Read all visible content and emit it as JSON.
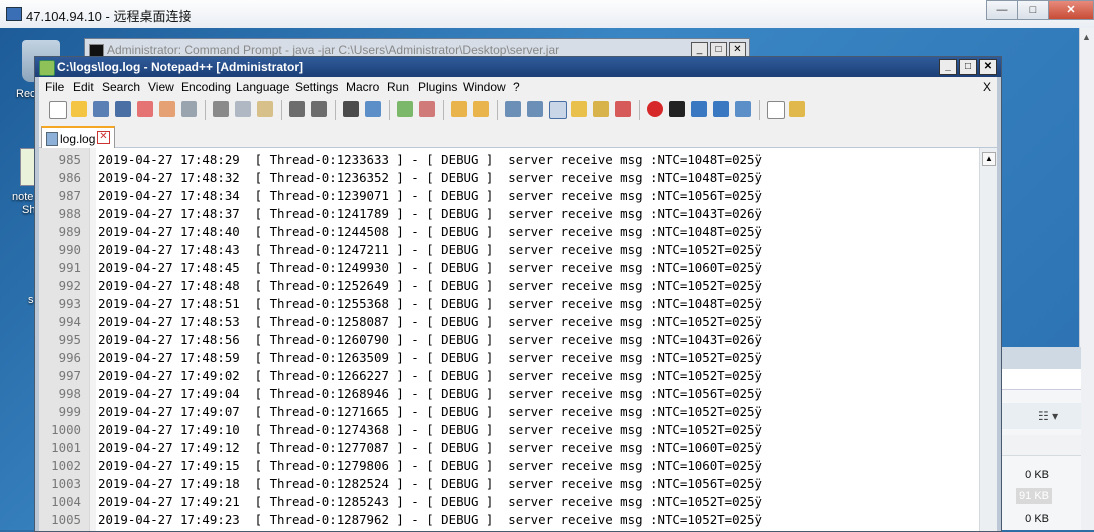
{
  "rdp": {
    "title": "47.104.94.10 - 远程桌面连接",
    "controls": [
      "—",
      "□",
      "✕"
    ]
  },
  "desktop": {
    "icon_labels": [
      "Rec",
      "note",
      "Sh",
      "s"
    ]
  },
  "cmd": {
    "title": "Administrator: Command Prompt - java -jar C:\\Users\\Administrator\\Desktop\\server.jar",
    "controls": [
      "_",
      "□",
      "✕"
    ]
  },
  "explorer": {
    "view_icon": "view-options-icon",
    "sizes": [
      "0 KB",
      "91 KB",
      "0 KB"
    ]
  },
  "npp": {
    "title": "C:\\logs\\log.log - Notepad++ [Administrator]",
    "controls": [
      "_",
      "□",
      "✕"
    ],
    "menu": [
      "File",
      "Edit",
      "Search",
      "View",
      "Encoding",
      "Language",
      "Settings",
      "Macro",
      "Run",
      "Plugins",
      "Window",
      "?"
    ],
    "menu_close": "X",
    "tab": {
      "name": "log.log",
      "close": "✕"
    }
  },
  "log_lines": [
    {
      "n": "985",
      "text": "2019-04-27 17:48:29  [ Thread-0:1233633 ] - [ DEBUG ]  server receive msg :NTC=1048T=025ÿ"
    },
    {
      "n": "986",
      "text": "2019-04-27 17:48:32  [ Thread-0:1236352 ] - [ DEBUG ]  server receive msg :NTC=1048T=025ÿ"
    },
    {
      "n": "987",
      "text": "2019-04-27 17:48:34  [ Thread-0:1239071 ] - [ DEBUG ]  server receive msg :NTC=1056T=025ÿ"
    },
    {
      "n": "988",
      "text": "2019-04-27 17:48:37  [ Thread-0:1241789 ] - [ DEBUG ]  server receive msg :NTC=1043T=026ÿ"
    },
    {
      "n": "989",
      "text": "2019-04-27 17:48:40  [ Thread-0:1244508 ] - [ DEBUG ]  server receive msg :NTC=1048T=025ÿ"
    },
    {
      "n": "990",
      "text": "2019-04-27 17:48:43  [ Thread-0:1247211 ] - [ DEBUG ]  server receive msg :NTC=1052T=025ÿ"
    },
    {
      "n": "991",
      "text": "2019-04-27 17:48:45  [ Thread-0:1249930 ] - [ DEBUG ]  server receive msg :NTC=1060T=025ÿ"
    },
    {
      "n": "992",
      "text": "2019-04-27 17:48:48  [ Thread-0:1252649 ] - [ DEBUG ]  server receive msg :NTC=1052T=025ÿ"
    },
    {
      "n": "993",
      "text": "2019-04-27 17:48:51  [ Thread-0:1255368 ] - [ DEBUG ]  server receive msg :NTC=1048T=025ÿ"
    },
    {
      "n": "994",
      "text": "2019-04-27 17:48:53  [ Thread-0:1258087 ] - [ DEBUG ]  server receive msg :NTC=1052T=025ÿ"
    },
    {
      "n": "995",
      "text": "2019-04-27 17:48:56  [ Thread-0:1260790 ] - [ DEBUG ]  server receive msg :NTC=1043T=026ÿ"
    },
    {
      "n": "996",
      "text": "2019-04-27 17:48:59  [ Thread-0:1263509 ] - [ DEBUG ]  server receive msg :NTC=1052T=025ÿ"
    },
    {
      "n": "997",
      "text": "2019-04-27 17:49:02  [ Thread-0:1266227 ] - [ DEBUG ]  server receive msg :NTC=1052T=025ÿ"
    },
    {
      "n": "998",
      "text": "2019-04-27 17:49:04  [ Thread-0:1268946 ] - [ DEBUG ]  server receive msg :NTC=1056T=025ÿ"
    },
    {
      "n": "999",
      "text": "2019-04-27 17:49:07  [ Thread-0:1271665 ] - [ DEBUG ]  server receive msg :NTC=1052T=025ÿ"
    },
    {
      "n": "1000",
      "text": "2019-04-27 17:49:10  [ Thread-0:1274368 ] - [ DEBUG ]  server receive msg :NTC=1052T=025ÿ"
    },
    {
      "n": "1001",
      "text": "2019-04-27 17:49:12  [ Thread-0:1277087 ] - [ DEBUG ]  server receive msg :NTC=1060T=025ÿ"
    },
    {
      "n": "1002",
      "text": "2019-04-27 17:49:15  [ Thread-0:1279806 ] - [ DEBUG ]  server receive msg :NTC=1060T=025ÿ"
    },
    {
      "n": "1003",
      "text": "2019-04-27 17:49:18  [ Thread-0:1282524 ] - [ DEBUG ]  server receive msg :NTC=1056T=025ÿ"
    },
    {
      "n": "1004",
      "text": "2019-04-27 17:49:21  [ Thread-0:1285243 ] - [ DEBUG ]  server receive msg :NTC=1052T=025ÿ"
    },
    {
      "n": "1005",
      "text": "2019-04-27 17:49:23  [ Thread-0:1287962 ] - [ DEBUG ]  server receive msg :NTC=1052T=025ÿ"
    }
  ]
}
